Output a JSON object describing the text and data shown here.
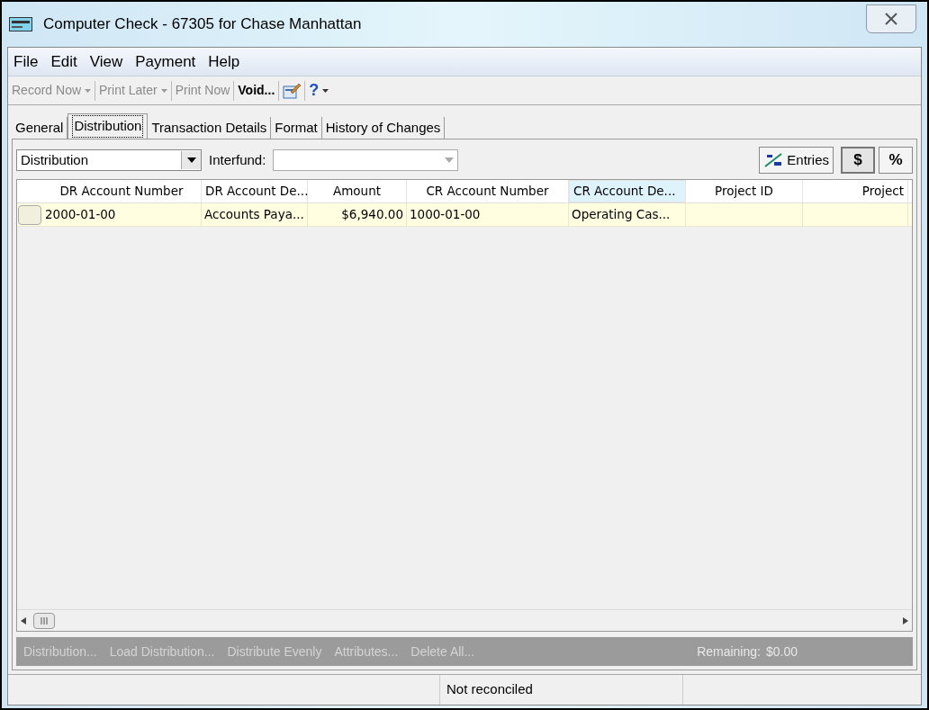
{
  "window": {
    "title": "Computer Check - 67305 for Chase Manhattan"
  },
  "menu": [
    "File",
    "Edit",
    "View",
    "Payment",
    "Help"
  ],
  "toolbar": [
    {
      "kind": "text",
      "label": "Record Now",
      "dropdown": true,
      "disabled": true
    },
    {
      "kind": "text",
      "label": "Print Later",
      "dropdown": true,
      "disabled": true
    },
    {
      "kind": "text",
      "label": "Print Now",
      "dropdown": false,
      "disabled": true
    },
    {
      "kind": "text",
      "label": "Void...",
      "dropdown": false,
      "disabled": false
    },
    {
      "kind": "icon",
      "dropdown": false,
      "disabled": false
    },
    {
      "kind": "help",
      "label": "?",
      "dropdown": true,
      "disabled": false
    }
  ],
  "tabs": [
    {
      "label": "General",
      "selected": false
    },
    {
      "label": "Distribution",
      "selected": true
    },
    {
      "label": "Transaction Details",
      "selected": false
    },
    {
      "label": "Format",
      "selected": false
    },
    {
      "label": "History of Changes",
      "selected": false
    }
  ],
  "distribution_select": {
    "value": "Distribution"
  },
  "interfund": {
    "label": "Interfund:",
    "disabled": true
  },
  "entries_button": {
    "label": "Entries"
  },
  "mode_buttons": [
    {
      "label": "$",
      "selected": true
    },
    {
      "label": "%",
      "selected": false
    }
  ],
  "table": {
    "columns": [
      {
        "label": "DR Account Number",
        "selected": false
      },
      {
        "label": "DR Account De...",
        "selected": false
      },
      {
        "label": "Amount",
        "selected": false
      },
      {
        "label": "CR Account Number",
        "selected": false
      },
      {
        "label": "CR Account De...",
        "selected": true
      },
      {
        "label": "Project ID",
        "selected": false
      },
      {
        "label": "Project",
        "selected": false
      }
    ],
    "rows": [
      [
        "2000-01-00",
        "Accounts Paya...",
        "$6,940.00",
        "1000-01-00",
        "Operating Cas...",
        "",
        ""
      ]
    ]
  },
  "actions": [
    "Distribution...",
    "Load Distribution...",
    "Distribute Evenly",
    "Attributes...",
    "Delete All..."
  ],
  "remaining": {
    "label": "Remaining:",
    "value": "$0.00"
  },
  "status_bar": [
    "Not reconciled"
  ]
}
